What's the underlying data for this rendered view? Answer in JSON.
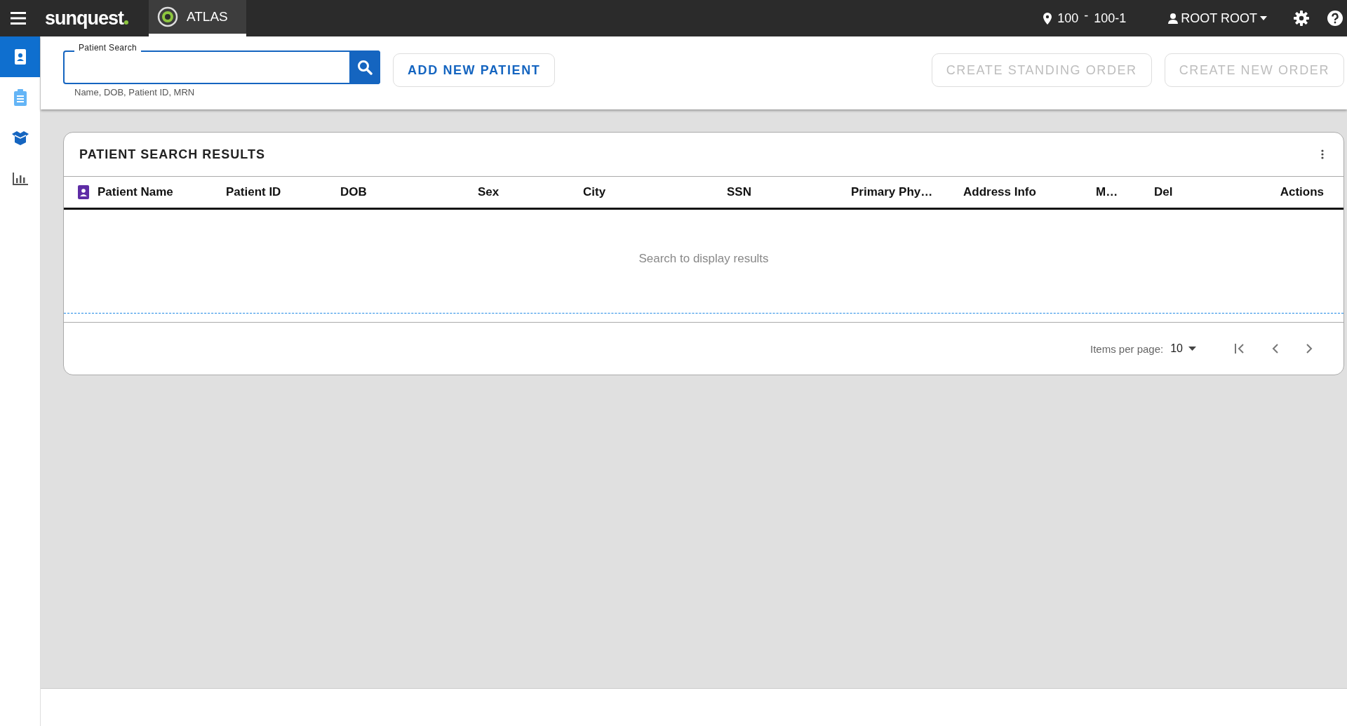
{
  "topbar": {
    "logo": "sunquest",
    "app_tab": {
      "label": "ATLAS",
      "selected": true
    },
    "location": {
      "site": "100",
      "separator": "-",
      "unit": "100-1"
    },
    "user": "ROOT ROOT"
  },
  "sidebar": {
    "items": [
      {
        "kind": "patient",
        "selected": true
      },
      {
        "kind": "orders",
        "selected": false
      },
      {
        "kind": "specimens",
        "selected": false
      },
      {
        "kind": "reports",
        "selected": false
      }
    ]
  },
  "toolbar": {
    "search": {
      "label": "Patient Search",
      "hint": "Name, DOB, Patient ID, MRN"
    },
    "left_buttons": [
      {
        "label": "ADD NEW PATIENT",
        "disabled": false
      }
    ],
    "right_buttons": [
      {
        "label": "CREATE STANDING ORDER",
        "disabled": true
      },
      {
        "label": "CREATE NEW ORDER",
        "disabled": true
      }
    ]
  },
  "results": {
    "title": "PATIENT SEARCH RESULTS",
    "columns": [
      "Patient Name",
      "Patient ID",
      "DOB",
      "Sex",
      "City",
      "SSN",
      "Primary Phy…",
      "Address Info",
      "M…",
      "Del",
      "Actions"
    ],
    "empty_message": "Search to display results",
    "paginator": {
      "label": "Items per page:",
      "page_size": "10"
    }
  }
}
